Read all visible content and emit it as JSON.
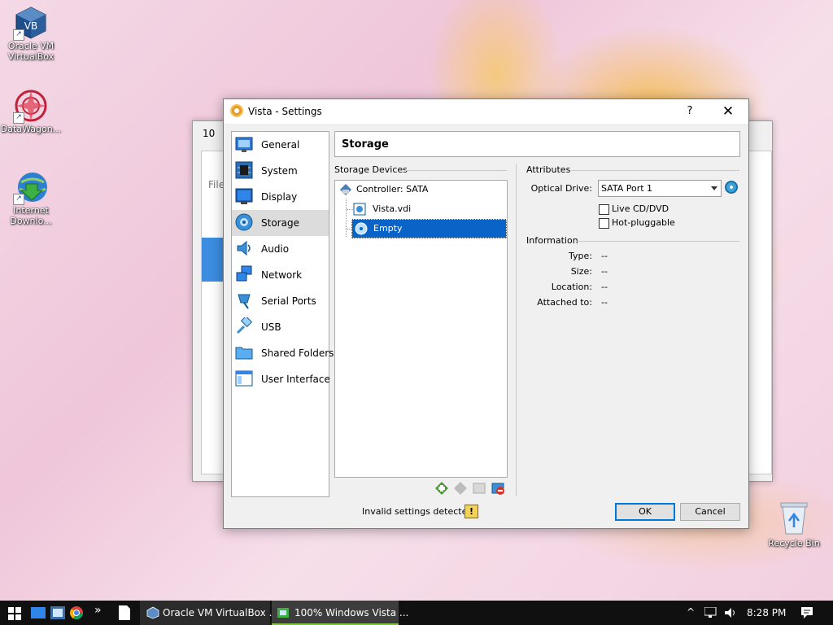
{
  "desktop": {
    "icons": [
      {
        "label": "Oracle VM VirtualBox"
      },
      {
        "label": "DataWagon..."
      },
      {
        "label": "Internet Downlo..."
      }
    ],
    "recycle_bin": "Recycle Bin"
  },
  "background_window": {
    "title_fragment": "10",
    "menu_fragment": "File"
  },
  "dialog": {
    "title": "Vista - Settings",
    "help": "?",
    "close": "✕",
    "nav": [
      {
        "label": "General",
        "icon": "general-icon"
      },
      {
        "label": "System",
        "icon": "system-icon"
      },
      {
        "label": "Display",
        "icon": "display-icon"
      },
      {
        "label": "Storage",
        "icon": "storage-icon",
        "selected": true
      },
      {
        "label": "Audio",
        "icon": "audio-icon"
      },
      {
        "label": "Network",
        "icon": "network-icon"
      },
      {
        "label": "Serial Ports",
        "icon": "serial-ports-icon"
      },
      {
        "label": "USB",
        "icon": "usb-icon"
      },
      {
        "label": "Shared Folders",
        "icon": "shared-folders-icon"
      },
      {
        "label": "User Interface",
        "icon": "user-interface-icon"
      }
    ],
    "section_title": "Storage",
    "storage_devices_label": "Storage Devices",
    "tree": {
      "controller": "Controller: SATA",
      "disk": "Vista.vdi",
      "optical": "Empty"
    },
    "attributes_label": "Attributes",
    "optical_drive_label": "Optical Drive:",
    "optical_drive_value": "SATA Port 1",
    "live_cd_label": "Live CD/DVD",
    "hot_pluggable_label": "Hot-pluggable",
    "information_label": "Information",
    "info": {
      "type_label": "Type:",
      "type_value": "--",
      "size_label": "Size:",
      "size_value": "--",
      "location_label": "Location:",
      "location_value": "--",
      "attached_label": "Attached to:",
      "attached_value": "--"
    },
    "status_text": "Invalid settings detected",
    "ok": "OK",
    "cancel": "Cancel"
  },
  "taskbar": {
    "overflow": "»",
    "tasks": [
      {
        "label": "Oracle VM VirtualBox ..."
      },
      {
        "label": "100% Windows Vista ..."
      }
    ],
    "tray_chevron": "^",
    "clock": "8:28 PM"
  }
}
